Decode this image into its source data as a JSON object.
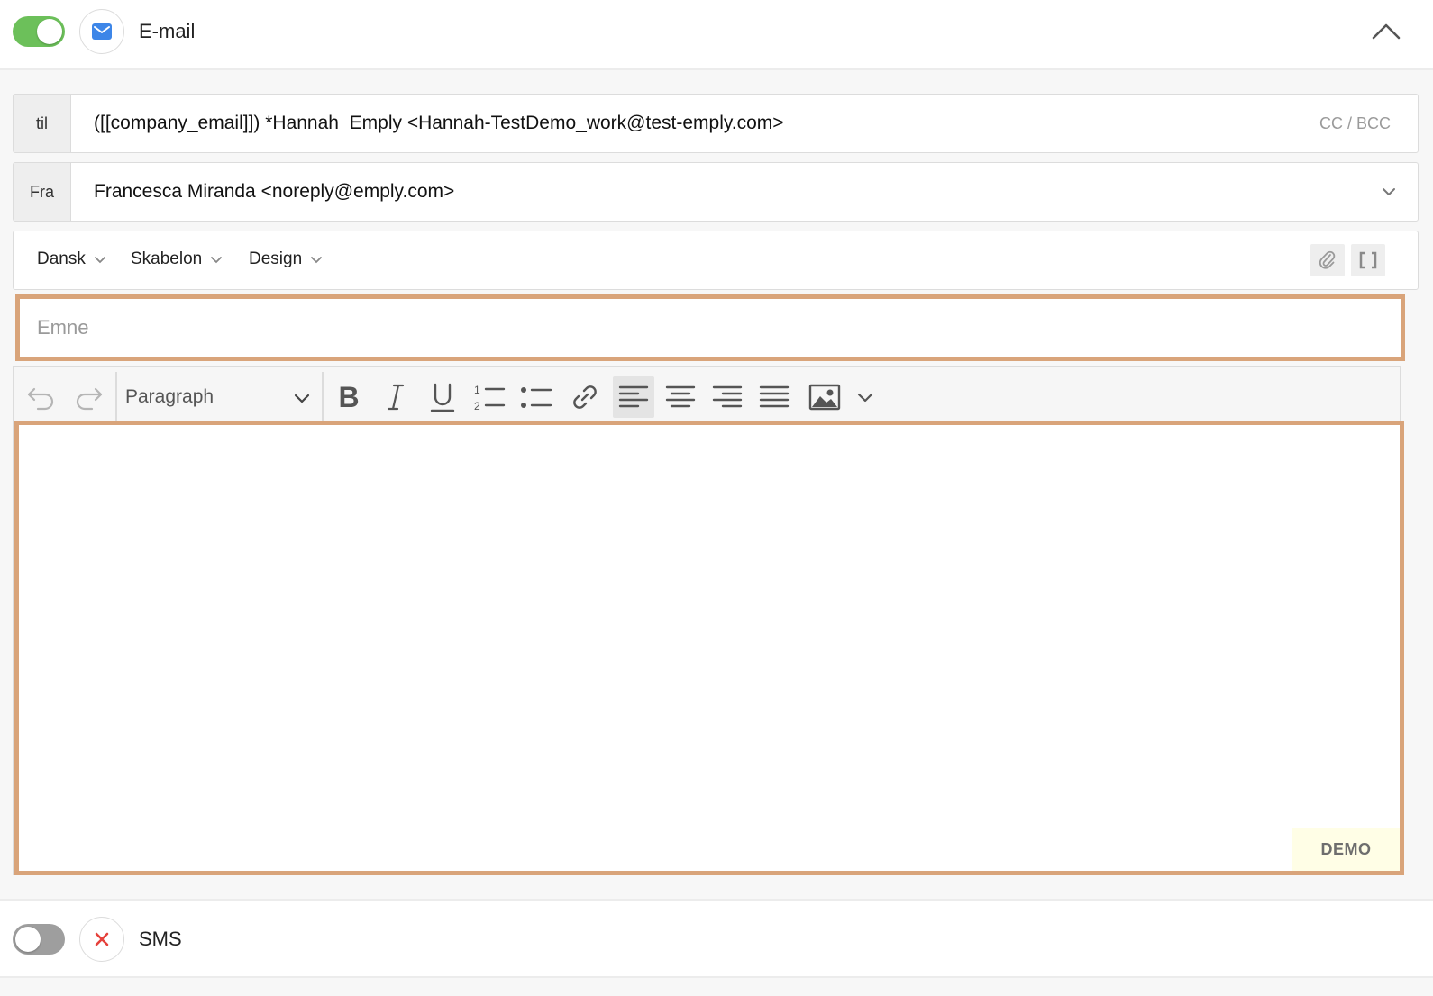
{
  "email_section": {
    "title": "E-mail",
    "toggle_on": true,
    "icon": "envelope-icon"
  },
  "to_field": {
    "label": "til",
    "value": "([[company_email]]) *Hannah  Emply <Hannah-TestDemo_work@test-emply.com>",
    "cc_bcc": "CC / BCC"
  },
  "from_field": {
    "label": "Fra",
    "value": "Francesca Miranda <noreply@emply.com>"
  },
  "options": {
    "language": "Dansk",
    "template": "Skabelon",
    "design": "Design"
  },
  "subject": {
    "placeholder": "Emne",
    "value": ""
  },
  "editor": {
    "block_format": "Paragraph",
    "active_alignment": "left",
    "badge": "DEMO"
  },
  "sms_section": {
    "title": "SMS",
    "toggle_on": false,
    "icon": "close-icon"
  },
  "colors": {
    "toggle_on": "#6cc05a",
    "toggle_off": "#9e9e9e",
    "envelope": "#3d86e8",
    "close": "#e5413b",
    "highlight": "#d9a47a"
  }
}
